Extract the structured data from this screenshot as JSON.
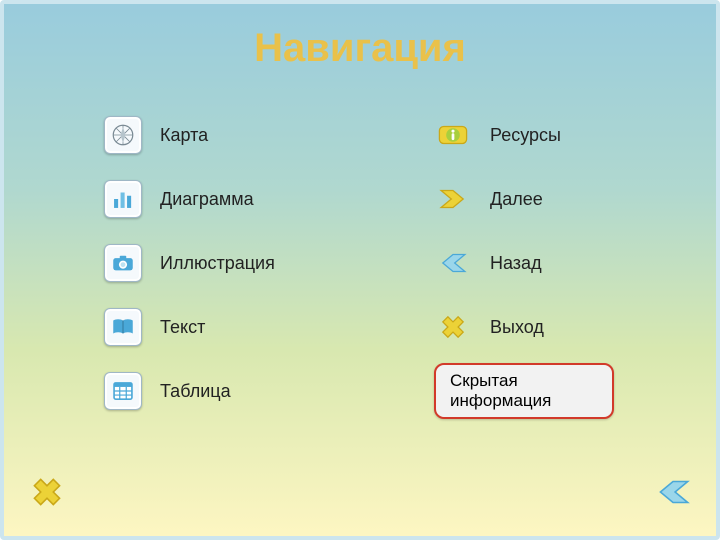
{
  "title": "Навигация",
  "left": {
    "items": [
      {
        "icon": "compass-icon",
        "label": "Карта"
      },
      {
        "icon": "chart-icon",
        "label": "Диаграмма"
      },
      {
        "icon": "camera-icon",
        "label": "Иллюстрация"
      },
      {
        "icon": "book-icon",
        "label": "Текст"
      },
      {
        "icon": "table-icon",
        "label": "Таблица"
      }
    ]
  },
  "right": {
    "items": [
      {
        "icon": "info-icon",
        "label": "Ресурсы"
      },
      {
        "icon": "arrow-next-icon",
        "label": "Далее"
      },
      {
        "icon": "arrow-back-icon",
        "label": "Назад"
      },
      {
        "icon": "close-x-icon",
        "label": "Выход"
      }
    ],
    "hidden_info_label": "Скрытая информация"
  },
  "colors": {
    "accent_title": "#e9c14a",
    "pill_border": "#d23a2a",
    "icon_blue": "#4aa8d8",
    "icon_yellow": "#ecd237",
    "icon_green": "#a8cf3e"
  }
}
